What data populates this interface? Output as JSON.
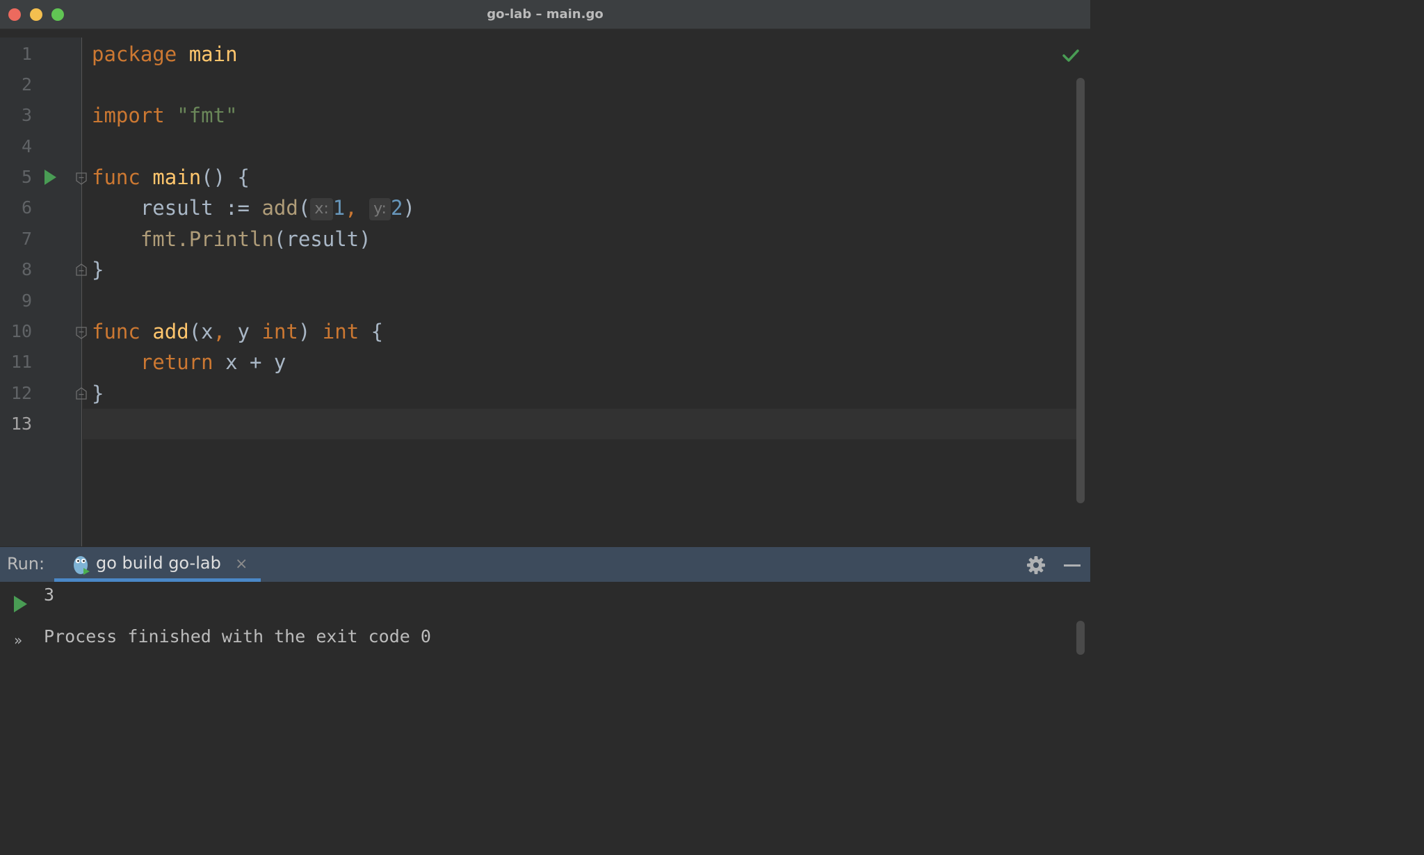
{
  "window": {
    "title": "go-lab – main.go"
  },
  "editor": {
    "line_numbers": [
      "1",
      "2",
      "3",
      "4",
      "5",
      "6",
      "7",
      "8",
      "9",
      "10",
      "11",
      "12",
      "13"
    ],
    "current_line": "13",
    "lines": {
      "l1": {
        "kw": "package",
        "name": "main"
      },
      "l3": {
        "kw": "import",
        "str": "\"fmt\""
      },
      "l5": {
        "kw": "func",
        "name": "main",
        "rest": "() {"
      },
      "l6": {
        "var": "result",
        "op": " := ",
        "call": "add",
        "open": "(",
        "hint_x": "x:",
        "arg1": "1",
        "comma": ", ",
        "hint_y": "y:",
        "arg2": "2",
        "close": ")"
      },
      "l7": {
        "pkg": "fmt",
        "dot": ".",
        "call": "Println",
        "args": "(result)"
      },
      "l8": {
        "brace": "}"
      },
      "l10": {
        "kw": "func",
        "name": "add",
        "params_open": "(x",
        "comma": ",",
        "params_y": " y ",
        "type1": "int",
        "params_close": ") ",
        "type2": "int",
        "brace": " {"
      },
      "l11": {
        "kw": "return",
        "expr": " x + y"
      },
      "l12": {
        "brace": "}"
      }
    }
  },
  "run_panel": {
    "label": "Run:",
    "tab_label": "go build go-lab",
    "tab_close": "×",
    "console": {
      "output": "3",
      "status": "Process finished with the exit code 0"
    }
  },
  "icons": {
    "status_check": "check-icon",
    "gutter_run": "run-gutter-icon",
    "tab": "gopher-icon",
    "settings": "gear-icon",
    "hide": "minimize-icon",
    "rerun": "rerun-icon",
    "more": "more-icon"
  },
  "colors": {
    "keyword": "#cc7832",
    "function": "#ffc66d",
    "string": "#6a8759",
    "number": "#6897bb",
    "identifier": "#a9b7c6",
    "run_green": "#499c54",
    "tab_accent": "#4a88c7"
  }
}
